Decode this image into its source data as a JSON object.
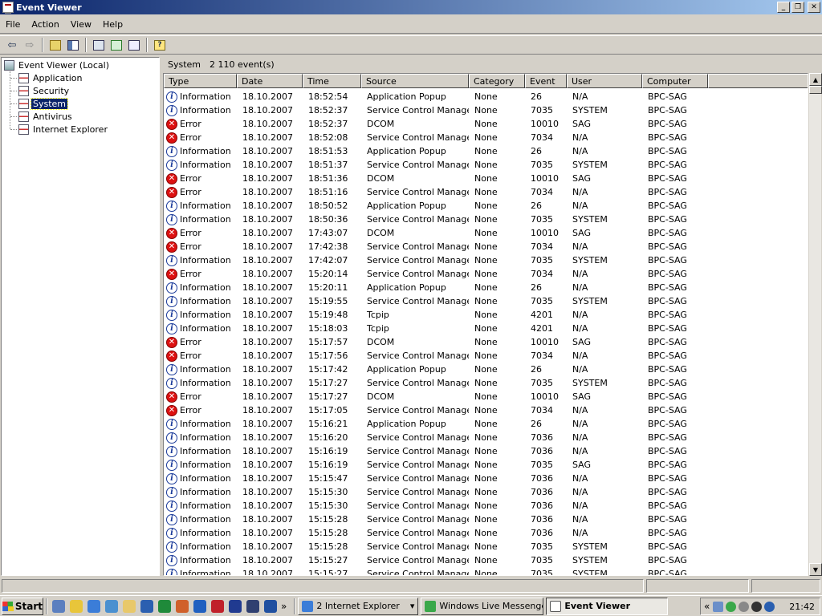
{
  "window": {
    "title": "Event Viewer"
  },
  "menu": [
    "File",
    "Action",
    "View",
    "Help"
  ],
  "toolbar": {
    "buttons": [
      "back-icon",
      "forward-icon",
      "up-folder-icon",
      "show-hide-tree-icon",
      "properties-icon",
      "refresh-icon",
      "export-list-icon",
      "help-icon"
    ]
  },
  "tree": {
    "root": "Event Viewer (Local)",
    "items": [
      "Application",
      "Security",
      "System",
      "Antivirus",
      "Internet Explorer"
    ],
    "selected": "System"
  },
  "list_header": {
    "log": "System",
    "count": "2 110 event(s)"
  },
  "columns": [
    "Type",
    "Date",
    "Time",
    "Source",
    "Category",
    "Event",
    "User",
    "Computer"
  ],
  "rows": [
    [
      "Information",
      "18.10.2007",
      "18:52:54",
      "Application Popup",
      "None",
      "26",
      "N/A",
      "BPC-SAG"
    ],
    [
      "Information",
      "18.10.2007",
      "18:52:37",
      "Service Control Manager",
      "None",
      "7035",
      "SYSTEM",
      "BPC-SAG"
    ],
    [
      "Error",
      "18.10.2007",
      "18:52:37",
      "DCOM",
      "None",
      "10010",
      "SAG",
      "BPC-SAG"
    ],
    [
      "Error",
      "18.10.2007",
      "18:52:08",
      "Service Control Manager",
      "None",
      "7034",
      "N/A",
      "BPC-SAG"
    ],
    [
      "Information",
      "18.10.2007",
      "18:51:53",
      "Application Popup",
      "None",
      "26",
      "N/A",
      "BPC-SAG"
    ],
    [
      "Information",
      "18.10.2007",
      "18:51:37",
      "Service Control Manager",
      "None",
      "7035",
      "SYSTEM",
      "BPC-SAG"
    ],
    [
      "Error",
      "18.10.2007",
      "18:51:36",
      "DCOM",
      "None",
      "10010",
      "SAG",
      "BPC-SAG"
    ],
    [
      "Error",
      "18.10.2007",
      "18:51:16",
      "Service Control Manager",
      "None",
      "7034",
      "N/A",
      "BPC-SAG"
    ],
    [
      "Information",
      "18.10.2007",
      "18:50:52",
      "Application Popup",
      "None",
      "26",
      "N/A",
      "BPC-SAG"
    ],
    [
      "Information",
      "18.10.2007",
      "18:50:36",
      "Service Control Manager",
      "None",
      "7035",
      "SYSTEM",
      "BPC-SAG"
    ],
    [
      "Error",
      "18.10.2007",
      "17:43:07",
      "DCOM",
      "None",
      "10010",
      "SAG",
      "BPC-SAG"
    ],
    [
      "Error",
      "18.10.2007",
      "17:42:38",
      "Service Control Manager",
      "None",
      "7034",
      "N/A",
      "BPC-SAG"
    ],
    [
      "Information",
      "18.10.2007",
      "17:42:07",
      "Service Control Manager",
      "None",
      "7035",
      "SYSTEM",
      "BPC-SAG"
    ],
    [
      "Error",
      "18.10.2007",
      "15:20:14",
      "Service Control Manager",
      "None",
      "7034",
      "N/A",
      "BPC-SAG"
    ],
    [
      "Information",
      "18.10.2007",
      "15:20:11",
      "Application Popup",
      "None",
      "26",
      "N/A",
      "BPC-SAG"
    ],
    [
      "Information",
      "18.10.2007",
      "15:19:55",
      "Service Control Manager",
      "None",
      "7035",
      "SYSTEM",
      "BPC-SAG"
    ],
    [
      "Information",
      "18.10.2007",
      "15:19:48",
      "Tcpip",
      "None",
      "4201",
      "N/A",
      "BPC-SAG"
    ],
    [
      "Information",
      "18.10.2007",
      "15:18:03",
      "Tcpip",
      "None",
      "4201",
      "N/A",
      "BPC-SAG"
    ],
    [
      "Error",
      "18.10.2007",
      "15:17:57",
      "DCOM",
      "None",
      "10010",
      "SAG",
      "BPC-SAG"
    ],
    [
      "Error",
      "18.10.2007",
      "15:17:56",
      "Service Control Manager",
      "None",
      "7034",
      "N/A",
      "BPC-SAG"
    ],
    [
      "Information",
      "18.10.2007",
      "15:17:42",
      "Application Popup",
      "None",
      "26",
      "N/A",
      "BPC-SAG"
    ],
    [
      "Information",
      "18.10.2007",
      "15:17:27",
      "Service Control Manager",
      "None",
      "7035",
      "SYSTEM",
      "BPC-SAG"
    ],
    [
      "Error",
      "18.10.2007",
      "15:17:27",
      "DCOM",
      "None",
      "10010",
      "SAG",
      "BPC-SAG"
    ],
    [
      "Error",
      "18.10.2007",
      "15:17:05",
      "Service Control Manager",
      "None",
      "7034",
      "N/A",
      "BPC-SAG"
    ],
    [
      "Information",
      "18.10.2007",
      "15:16:21",
      "Application Popup",
      "None",
      "26",
      "N/A",
      "BPC-SAG"
    ],
    [
      "Information",
      "18.10.2007",
      "15:16:20",
      "Service Control Manager",
      "None",
      "7036",
      "N/A",
      "BPC-SAG"
    ],
    [
      "Information",
      "18.10.2007",
      "15:16:19",
      "Service Control Manager",
      "None",
      "7036",
      "N/A",
      "BPC-SAG"
    ],
    [
      "Information",
      "18.10.2007",
      "15:16:19",
      "Service Control Manager",
      "None",
      "7035",
      "SAG",
      "BPC-SAG"
    ],
    [
      "Information",
      "18.10.2007",
      "15:15:47",
      "Service Control Manager",
      "None",
      "7036",
      "N/A",
      "BPC-SAG"
    ],
    [
      "Information",
      "18.10.2007",
      "15:15:30",
      "Service Control Manager",
      "None",
      "7036",
      "N/A",
      "BPC-SAG"
    ],
    [
      "Information",
      "18.10.2007",
      "15:15:30",
      "Service Control Manager",
      "None",
      "7036",
      "N/A",
      "BPC-SAG"
    ],
    [
      "Information",
      "18.10.2007",
      "15:15:28",
      "Service Control Manager",
      "None",
      "7036",
      "N/A",
      "BPC-SAG"
    ],
    [
      "Information",
      "18.10.2007",
      "15:15:28",
      "Service Control Manager",
      "None",
      "7036",
      "N/A",
      "BPC-SAG"
    ],
    [
      "Information",
      "18.10.2007",
      "15:15:28",
      "Service Control Manager",
      "None",
      "7035",
      "SYSTEM",
      "BPC-SAG"
    ],
    [
      "Information",
      "18.10.2007",
      "15:15:27",
      "Service Control Manager",
      "None",
      "7035",
      "SYSTEM",
      "BPC-SAG"
    ],
    [
      "Information",
      "18.10.2007",
      "15:15:27",
      "Service Control Manager",
      "None",
      "7035",
      "SYSTEM",
      "BPC-SAG"
    ]
  ],
  "taskbar": {
    "start": "Start",
    "quicklaunch": [
      "show-desktop-icon",
      "explorer-icon",
      "internet-explorer-icon",
      "outlook-icon",
      "folder-icon",
      "word-icon",
      "excel-icon",
      "powerpoint-icon",
      "messenger-icon",
      "acrobat-icon",
      "app-icon",
      "app-icon",
      "app-icon"
    ],
    "chevron": "»",
    "tasks": [
      {
        "label": "2 Internet Explorer",
        "icon": "internet-explorer-icon",
        "active": false,
        "dropdown": "▾"
      },
      {
        "label": "Windows Live Messenger",
        "icon": "messenger-icon",
        "active": false
      },
      {
        "label": "Event Viewer",
        "icon": "event-viewer-icon",
        "active": true
      }
    ],
    "tray_chevron": "«",
    "clock": "21:42"
  },
  "colors": {
    "title_start": "#0a246a",
    "title_end": "#a6caf0",
    "selection": "#0a246a",
    "error": "#dd1111",
    "info": "#1a3a9a",
    "chrome": "#d4d0c8"
  }
}
